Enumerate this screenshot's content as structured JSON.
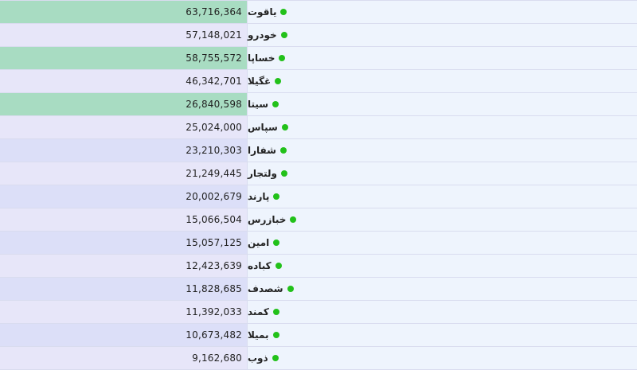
{
  "colors": {
    "green_cell": "#a8dcc2",
    "purple_dark": "#dcdff8",
    "purple_light": "#e7e6f9",
    "name_bg": "#eef4fd",
    "status_dot": "#22c11a"
  },
  "rows": [
    {
      "name": "یاقوت",
      "value": "63,716,364",
      "tone": "green"
    },
    {
      "name": "خودرو",
      "value": "57,148,021",
      "tone": "light"
    },
    {
      "name": "خساپا",
      "value": "58,755,572",
      "tone": "green"
    },
    {
      "name": "غگیلا",
      "value": "46,342,701",
      "tone": "light"
    },
    {
      "name": "سیتا",
      "value": "26,840,598",
      "tone": "green"
    },
    {
      "name": "سپاس",
      "value": "25,024,000",
      "tone": "light"
    },
    {
      "name": "شفارا",
      "value": "23,210,303",
      "tone": "dark"
    },
    {
      "name": "ولتجار",
      "value": "21,249,445",
      "tone": "light"
    },
    {
      "name": "پارند",
      "value": "20,002,679",
      "tone": "dark"
    },
    {
      "name": "خبازرس",
      "value": "15,066,504",
      "tone": "light"
    },
    {
      "name": "امین",
      "value": "15,057,125",
      "tone": "dark"
    },
    {
      "name": "کباده",
      "value": "12,423,639",
      "tone": "light"
    },
    {
      "name": "شصدف",
      "value": "11,828,685",
      "tone": "dark"
    },
    {
      "name": "کمند",
      "value": "11,392,033",
      "tone": "light"
    },
    {
      "name": "بمیلا",
      "value": "10,673,482",
      "tone": "dark"
    },
    {
      "name": "ذوب",
      "value": "9,162,680",
      "tone": "light"
    }
  ]
}
